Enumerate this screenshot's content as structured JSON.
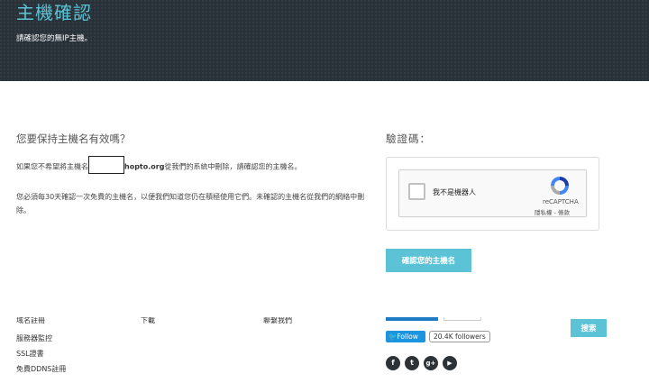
{
  "header": {
    "title": "主機確認",
    "subtitle": "請確認您的無IP主機。"
  },
  "main": {
    "heading": "您要保持主機名有效嗎？",
    "paragraph1_pre": "如果您不希望將主機名",
    "paragraph1_domain": "hopto.org",
    "paragraph1_post": "從我們的系統中刪除，請確認您的主機名。",
    "paragraph2": "您必須每30天確認一次免費的主機名，以便我們知道您仍在積極使用它們。未確認的主機名從我們的網絡中刪除。"
  },
  "captcha": {
    "heading": "驗證碼：",
    "checkbox_label": "我不是機器人",
    "brand": "reCAPTCHA",
    "privacy_link": "隱私權",
    "terms_link": "條款",
    "link_separator": " - "
  },
  "verify_button": "確認您的主機名",
  "footer": {
    "col1": [
      "服務器監控",
      "SSL證書",
      "免費DDNS註冊"
    ],
    "col1_cut": "域名註冊",
    "col2_cut": "下載",
    "col3_cut": "聯繫我們",
    "twitter_follow": "Follow",
    "twitter_followers": "20.4K followers",
    "search_button": "搜索",
    "social": [
      {
        "icon": "facebook-icon",
        "glyph": "f"
      },
      {
        "icon": "twitter-icon",
        "glyph": "t"
      },
      {
        "icon": "google-plus-icon",
        "glyph": "g+"
      },
      {
        "icon": "youtube-icon",
        "glyph": "▶"
      }
    ]
  }
}
